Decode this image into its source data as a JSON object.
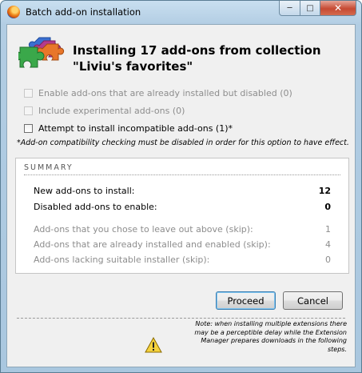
{
  "window": {
    "title": "Batch add-on installation",
    "buttons": {
      "minimize": "─",
      "maximize": "□",
      "close": "✕"
    }
  },
  "header": {
    "line1": "Installing 17 add-ons from collection",
    "line2": "\"Liviu's favorites\"",
    "icon": "puzzle-pieces-icon"
  },
  "options": [
    {
      "label": "Enable add-ons that are already installed but disabled (0)",
      "enabled": false,
      "checked": false
    },
    {
      "label": "Include experimental add-ons (0)",
      "enabled": false,
      "checked": false
    },
    {
      "label": "Attempt to install incompatible add-ons (1)*",
      "enabled": true,
      "checked": false
    }
  ],
  "compat_note": "*Add-on compatibility checking must be disabled in order for this option to have effect.",
  "summary": {
    "title": "SUMMARY",
    "rows": [
      {
        "label": "New add-ons to install:",
        "value": "12"
      },
      {
        "label": "Disabled add-ons to enable:",
        "value": "0"
      },
      {
        "label": "Add-ons that you chose to leave out above (skip):",
        "value": "1"
      },
      {
        "label": "Add-ons that are already installed and enabled (skip):",
        "value": "4"
      },
      {
        "label": "Add-ons lacking suitable installer (skip):",
        "value": "0"
      }
    ]
  },
  "buttons": {
    "proceed": "Proceed",
    "cancel": "Cancel"
  },
  "bottom_note": {
    "lines": [
      "Note: when installing multiple extensions there",
      "may be a perceptible delay while the Extension",
      "Manager prepares downloads in the following",
      "steps."
    ],
    "icon": "warning-icon"
  }
}
